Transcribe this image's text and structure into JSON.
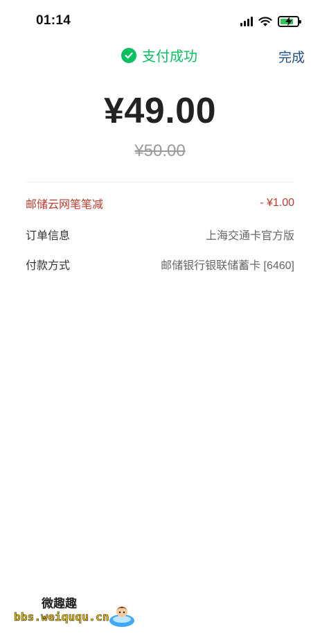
{
  "status_bar": {
    "time": "01:14",
    "icons": [
      "signal-icon",
      "wifi-icon",
      "battery-charging-icon"
    ],
    "battery_color": "#32c759"
  },
  "header": {
    "title": "支付成功",
    "done_label": "完成",
    "status_icon": "check-circle-icon",
    "accent_color": "#07c160"
  },
  "payment": {
    "amount": "¥49.00",
    "original_amount": "¥50.00"
  },
  "details": {
    "discount": {
      "label": "邮储云网笔笔减",
      "value": "- ¥1.00",
      "color": "#c0392b"
    },
    "order": {
      "label": "订单信息",
      "value": "上海交通卡官方版"
    },
    "method": {
      "label": "付款方式",
      "value": "邮储银行银联储蓄卡 [6460]"
    }
  },
  "watermark": {
    "title": "微趣趣",
    "url": "bbs.weiququ.cn"
  }
}
